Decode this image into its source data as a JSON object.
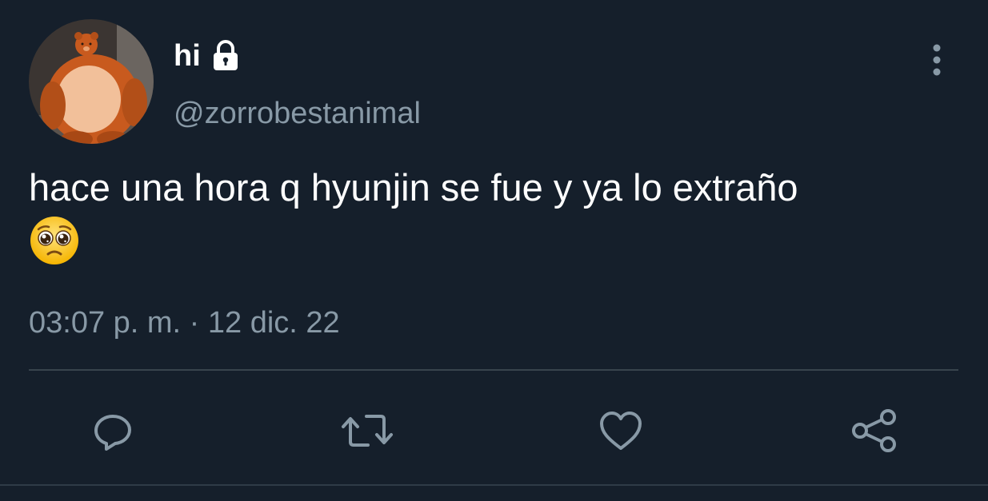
{
  "author": {
    "display_name": "hi",
    "handle": "@zorrobestanimal",
    "avatar": "orange-teddy-bear-plush",
    "protected_icon": "lock-icon"
  },
  "tweet": {
    "text": "hace una hora q hyunjin se fue y ya lo extraño",
    "emoji": "pleading-face-emoji",
    "timestamp": "03:07 p. m. · 12 dic. 22"
  },
  "actions": [
    {
      "name": "reply",
      "icon": "reply-icon"
    },
    {
      "name": "retweet",
      "icon": "retweet-icon"
    },
    {
      "name": "like",
      "icon": "heart-icon"
    },
    {
      "name": "share",
      "icon": "share-icon"
    }
  ],
  "colors": {
    "background": "#151f2b",
    "text_primary": "#ffffff",
    "text_secondary": "#8899a6",
    "divider": "#38444d"
  }
}
